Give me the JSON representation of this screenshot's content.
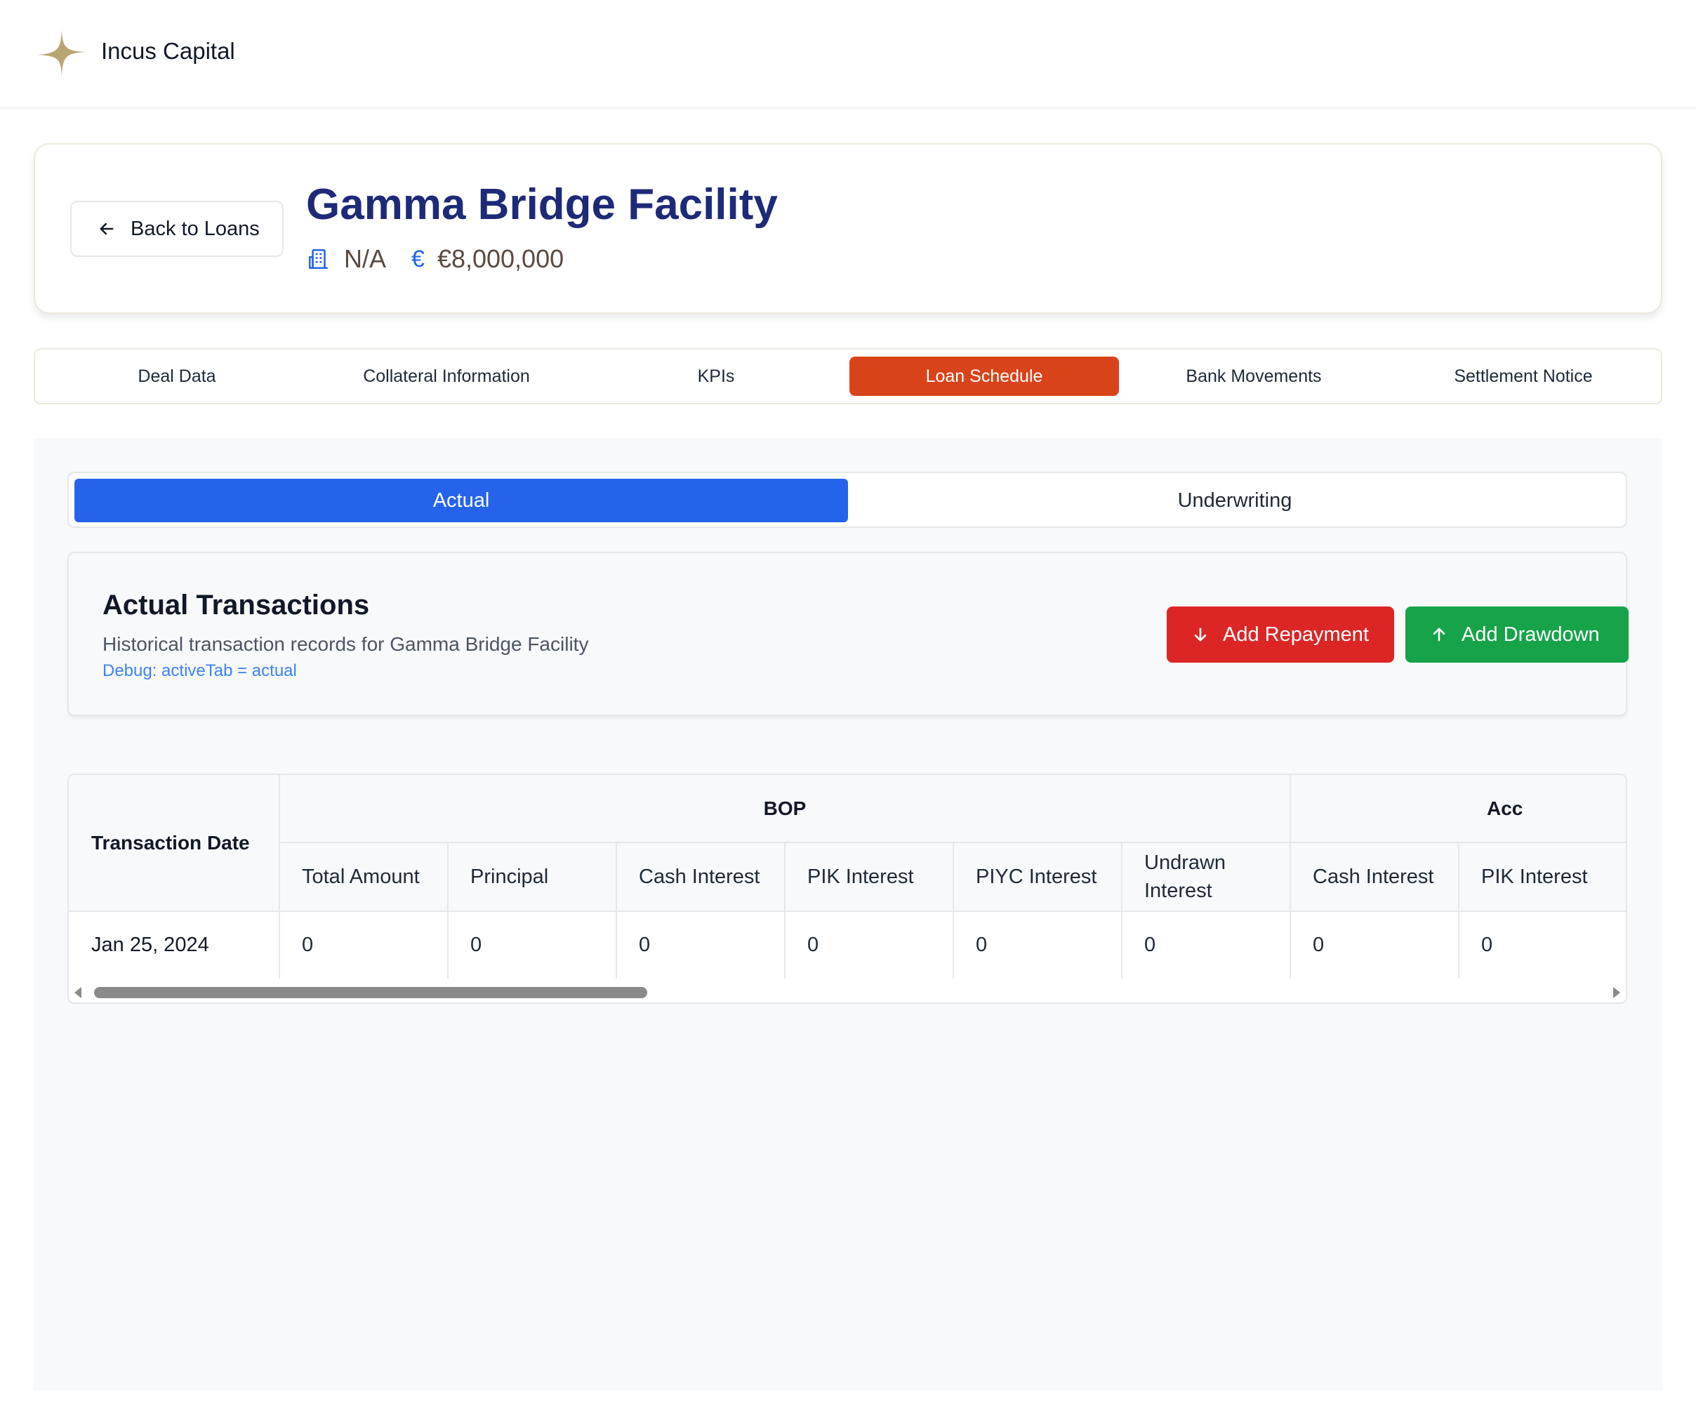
{
  "brand": {
    "name": "Incus Capital",
    "logo_color": "#b8a571"
  },
  "header": {
    "back_label": "Back to Loans",
    "deal_title": "Gamma Bridge Facility",
    "company": "N/A",
    "amount": "€8,000,000",
    "currency_symbol": "€"
  },
  "tabs": [
    {
      "label": "Deal Data",
      "active": false
    },
    {
      "label": "Collateral Information",
      "active": false
    },
    {
      "label": "KPIs",
      "active": false
    },
    {
      "label": "Loan Schedule",
      "active": true
    },
    {
      "label": "Bank Movements",
      "active": false
    },
    {
      "label": "Settlement Notice",
      "active": false
    }
  ],
  "schedule_tabs": [
    {
      "label": "Actual",
      "active": true
    },
    {
      "label": "Underwriting",
      "active": false
    }
  ],
  "transactions": {
    "title": "Actual Transactions",
    "subtitle": "Historical transaction records for Gamma Bridge Facility",
    "debug": "Debug: activeTab = actual",
    "repay_label": "Add Repayment",
    "drawdown_label": "Add Drawdown"
  },
  "table": {
    "date_header": "Transaction Date",
    "groups": [
      "BOP",
      "Acc"
    ],
    "bop_columns": [
      "Total Amount",
      "Principal",
      "Cash Interest",
      "PIK Interest",
      "PIYC Interest",
      "Undrawn Interest"
    ],
    "acc_columns": [
      "Cash Interest",
      "PIK Interest"
    ],
    "rows": [
      {
        "date": "Jan 25, 2024",
        "values": [
          "0",
          "0",
          "0",
          "0",
          "0",
          "0",
          "0",
          "0"
        ]
      }
    ]
  },
  "colors": {
    "title": "#1e2a78",
    "active_tab": "#d9431a",
    "actual_tab": "#2563eb",
    "repay": "#dc2626",
    "drawdown": "#16a34a"
  }
}
